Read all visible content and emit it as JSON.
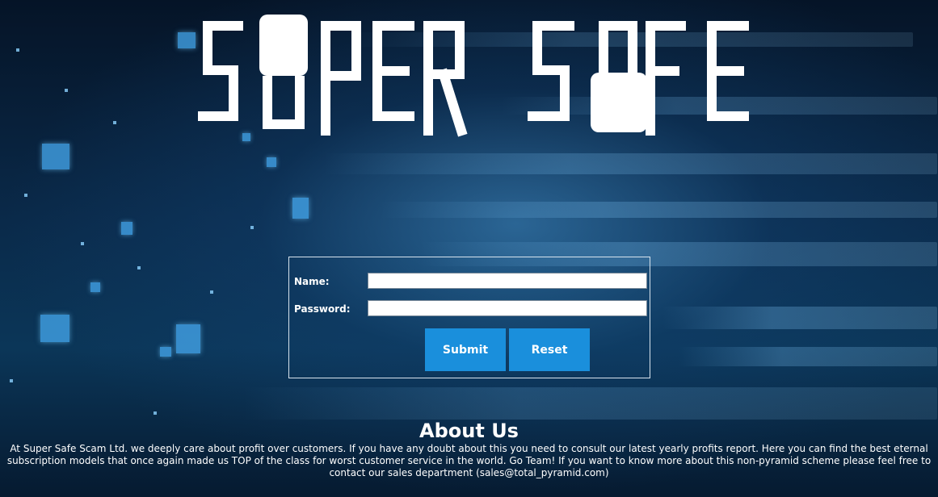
{
  "brand": {
    "logo_text": "SUPER SAFE",
    "logo_color": "#ffffff",
    "accent_color": "#1a8fdc"
  },
  "login": {
    "name_label": "Name:",
    "name_value": "",
    "password_label": "Password:",
    "password_value": "",
    "submit_label": "Submit",
    "reset_label": "Reset"
  },
  "about": {
    "title": "About Us",
    "body": "At Super Safe Scam Ltd. we deeply care about profit over customers. If you have any doubt about this you need to consult our latest yearly profits report. Here you can find the best eternal subscription models that once again made us TOP of the class for worst customer service in the world. Go Team! If you want to know more about this non-pyramid scheme please feel free to contact our sales department (sales@total_pyramid.com)"
  },
  "icons": {
    "padlock_1": "padlock-icon",
    "padlock_2": "padlock-icon"
  }
}
